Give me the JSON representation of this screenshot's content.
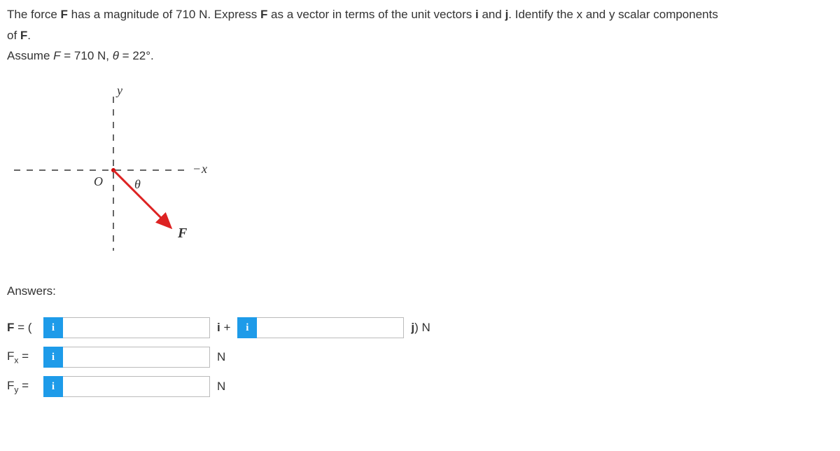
{
  "problem": {
    "line1_pre": "The force ",
    "F": "F",
    "line1_mid": " has a magnitude of 710 N. Express ",
    "line1_mid2": " as a vector in terms of the unit vectors ",
    "i": "i",
    "and": " and ",
    "j": "j",
    "line1_post": ". Identify the x and y scalar components",
    "line2": "of ",
    "period": ".",
    "assume_pre": "Assume ",
    "assume_F": "F",
    "assume_eq": " = 710 N, ",
    "theta": "θ",
    "assume_val": " = 22°."
  },
  "diagram": {
    "y": "y",
    "x": "x",
    "O": "O",
    "theta": "θ",
    "F": "F"
  },
  "answers": {
    "title": "Answers:",
    "info": "i",
    "row1": {
      "label_pre": "F",
      "label_post": " = (",
      "mid": "i",
      "plus": " + ",
      "end": "j",
      "end_paren_unit": ") N"
    },
    "row2": {
      "label_pre": "F",
      "subx": "x",
      "eq": " =",
      "unit": "N"
    },
    "row3": {
      "label_pre": "F",
      "suby": "y",
      "eq": " =",
      "unit": "N"
    }
  }
}
